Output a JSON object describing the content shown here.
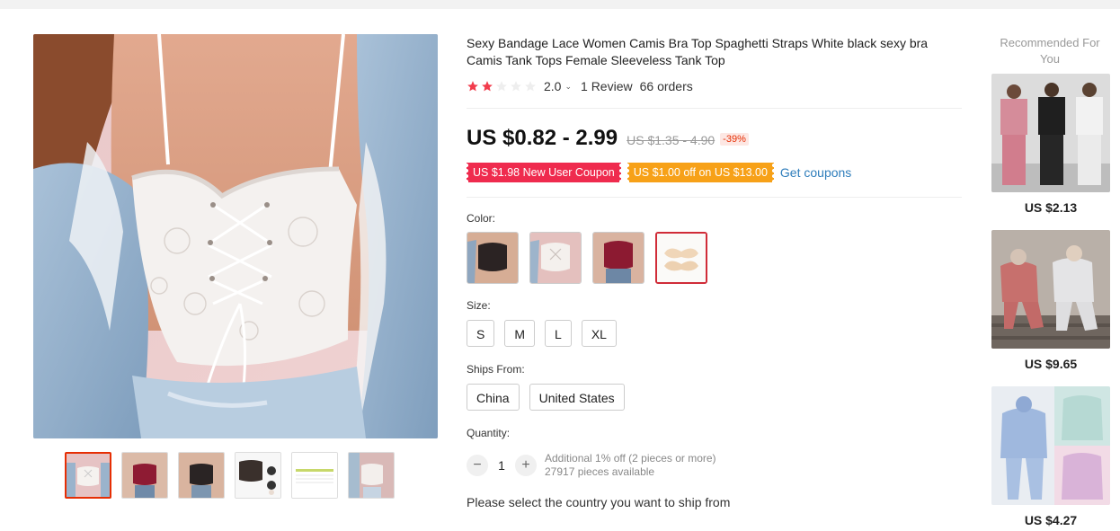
{
  "product": {
    "title": "Sexy Bandage Lace Women Camis Bra Top Spaghetti Straps White black sexy bra Camis Tank Tops Female Sleeveless Tank Top",
    "rating": 2.0,
    "rating_text": "2.0",
    "reviews": "1 Review",
    "orders": "66 orders",
    "price": "US $0.82 - 2.99",
    "original_price": "US $1.35 - 4.90",
    "discount": "-39%",
    "coupons": [
      {
        "text": "US $1.98 New User Coupon",
        "color": "#ef2b4e"
      },
      {
        "text": "US $1.00 off on US $13.00",
        "color": "#f7a118"
      }
    ],
    "get_coupons": "Get coupons"
  },
  "color_section": {
    "label": "Color:",
    "swatches": [
      "black-lace-top",
      "white-lace-top",
      "burgundy-lace-top",
      "nipple-covers"
    ],
    "selected_index": 3
  },
  "size_section": {
    "label": "Size:",
    "options": [
      "S",
      "M",
      "L",
      "XL"
    ]
  },
  "ships_from": {
    "label": "Ships From:",
    "options": [
      "China",
      "United States"
    ]
  },
  "quantity": {
    "label": "Quantity:",
    "value": "1",
    "minus": "−",
    "plus": "+",
    "note": "Additional 1% off (2 pieces or more)",
    "available": "27917 pieces available"
  },
  "ship_message": "Please select the country you want to ship from",
  "gallery": {
    "thumbnails": [
      "white-lace-top",
      "burgundy-lace-top",
      "black-lace-top",
      "black-top-variants",
      "size-chart",
      "white-lace-top-2"
    ],
    "selected_index": 0
  },
  "recommended": {
    "title": "Recommended For You",
    "items": [
      {
        "price": "US $2.13",
        "image": "tracksuit-models"
      },
      {
        "price": "US $9.65",
        "image": "sweatsuit-models"
      },
      {
        "price": "US $4.27",
        "image": "tie-dye-hoodie-sets"
      }
    ]
  },
  "colors": {
    "accent": "#e62e04",
    "link": "#2e7dbb",
    "star": "#f23c4c"
  }
}
